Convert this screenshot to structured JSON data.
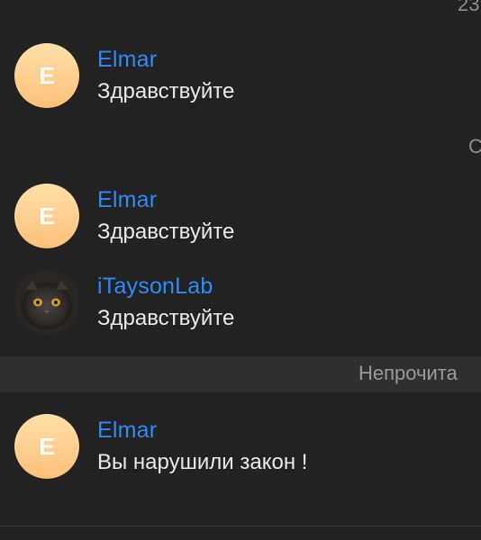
{
  "dates": {
    "top": "23",
    "middle": "С"
  },
  "messages": [
    {
      "sender": "Elmar",
      "avatar_letter": "E",
      "text": "Здравствуйте"
    },
    {
      "sender": "Elmar",
      "avatar_letter": "E",
      "text": "Здравствуйте"
    },
    {
      "sender": "iTaysonLab",
      "avatar_letter": "",
      "text": "Здравствуйте"
    },
    {
      "sender": "Elmar",
      "avatar_letter": "E",
      "text": "Вы нарушили закон !"
    }
  ],
  "unread_divider": {
    "label": "Непрочита"
  },
  "colors": {
    "background": "#222222",
    "sender_name": "#2f8cf7",
    "message_text": "#eaeaea",
    "divider_bg": "#2f2f2f",
    "avatar_gradient_top": "#ffe0a8",
    "avatar_gradient_bottom": "#ffc079"
  },
  "icons": {
    "avatar_photo": "cat-avatar-icon"
  }
}
